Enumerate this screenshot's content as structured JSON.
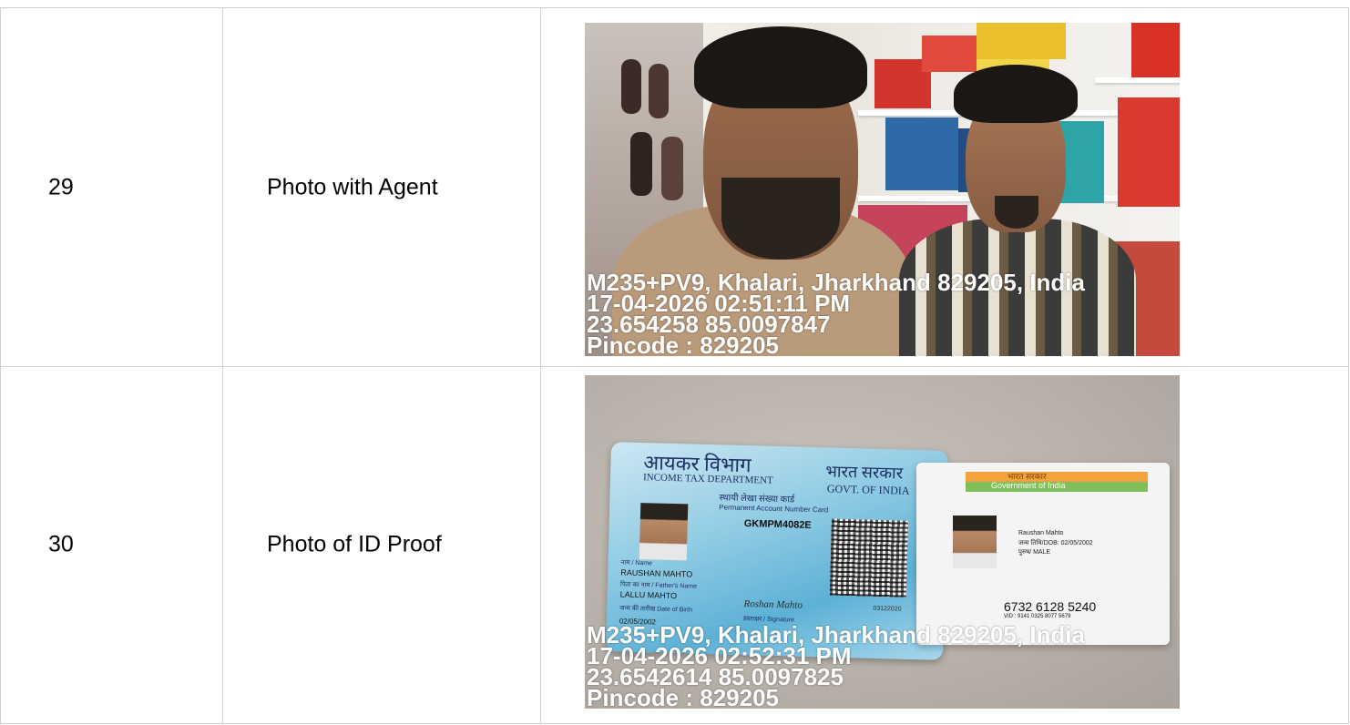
{
  "rows": [
    {
      "number": "29",
      "label": "Photo with Agent",
      "photo": {
        "overlay": [
          "M235+PV9, Khalari, Jharkhand 829205, India",
          "17-04-2026 02:51:11 PM",
          "23.654258 85.0097847",
          "Pincode : 829205"
        ]
      }
    },
    {
      "number": "30",
      "label": "Photo of ID Proof",
      "photo": {
        "overlay": [
          "M235+PV9, Khalari, Jharkhand 829205, India",
          "17-04-2026 02:52:31 PM",
          "23.6542614 85.0097825",
          "Pincode : 829205"
        ],
        "pan_card": {
          "dept_hi": "आयकर विभाग",
          "dept_en": "INCOME TAX DEPARTMENT",
          "govt_hi": "भारत सरकार",
          "govt_en": "GOVT. OF INDIA",
          "pan_title_hi": "स्थायी लेखा संख्या कार्ड",
          "pan_title_en": "Permanent Account Number Card",
          "pan_number": "GKMPM4082E",
          "name_label": "नाम / Name",
          "name": "RAUSHAN MAHTO",
          "father_label": "पिता का नाम / Father's Name",
          "father": "LALLU MAHTO",
          "dob_label": "जन्म की तारीख Date of Birth",
          "dob": "02/05/2002",
          "signature_label": "हस्ताक्षर / Signature",
          "signature": "Roshan Mahto",
          "code": "03122020"
        },
        "aadhaar_card": {
          "govt_hi": "भारत सरकार",
          "govt_en": "Government of India",
          "name": "Raushan Mahto",
          "dob": "जन्म तिथि/DOB: 02/05/2002",
          "gender": "पुरुष/ MALE",
          "number": "6732 6128 5240",
          "vid": "VID : 9141 0325 8077 5679"
        }
      }
    }
  ]
}
